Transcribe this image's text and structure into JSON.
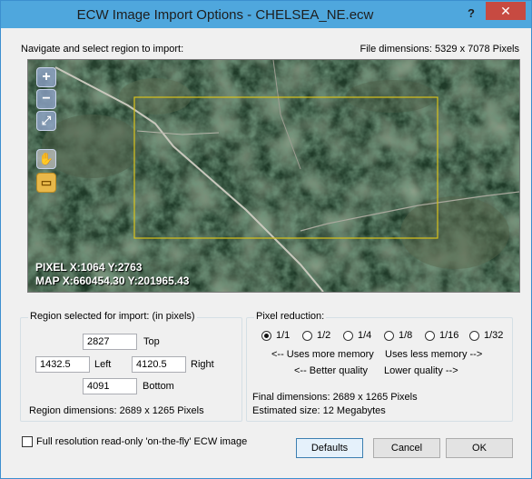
{
  "window": {
    "title": "ECW Image Import Options - CHELSEA_NE.ecw",
    "help_label": "?",
    "close_label": "✕"
  },
  "navigate_label": "Navigate and select region to import:",
  "file_dimensions": "File dimensions:  5329 x 7078 Pixels",
  "map": {
    "tools": [
      {
        "name": "zoom-in-icon",
        "glyph": "+"
      },
      {
        "name": "zoom-out-icon",
        "glyph": "−"
      },
      {
        "name": "zoom-fit-icon",
        "glyph": "⤢"
      },
      {
        "name": "pan-hand-icon",
        "glyph": "✋"
      },
      {
        "name": "select-region-icon",
        "glyph": "▭"
      }
    ],
    "pixel_readout": "PIXEL  X:1064  Y:2763",
    "map_readout": "MAP  X:660454.30  Y:201965.43",
    "selection_color": "#d9c21a"
  },
  "region": {
    "group_title": "Region selected for import:  (in pixels)",
    "top_value": "2827",
    "top_label": "Top",
    "left_value": "1432.5",
    "left_label": "Left",
    "right_value": "4120.5",
    "right_label": "Right",
    "bottom_value": "4091",
    "bottom_label": "Bottom",
    "dimensions": "Region dimensions:  2689 x 1265 Pixels"
  },
  "pixel_reduction": {
    "group_title": "Pixel reduction:",
    "options": [
      "1/1",
      "1/2",
      "1/4",
      "1/8",
      "1/16",
      "1/32"
    ],
    "selected": "1/1",
    "more_memory": "<-- Uses more memory",
    "less_memory": "Uses less memory -->",
    "better_quality": "<-- Better quality",
    "lower_quality": "Lower quality -->",
    "final_dimensions": "Final dimensions:  2689 x 1265 Pixels",
    "estimated_size": "Estimated size:  12 Megabytes"
  },
  "full_resolution_label": "Full resolution read-only 'on-the-fly' ECW image",
  "buttons": {
    "defaults": "Defaults",
    "cancel": "Cancel",
    "ok": "OK"
  }
}
